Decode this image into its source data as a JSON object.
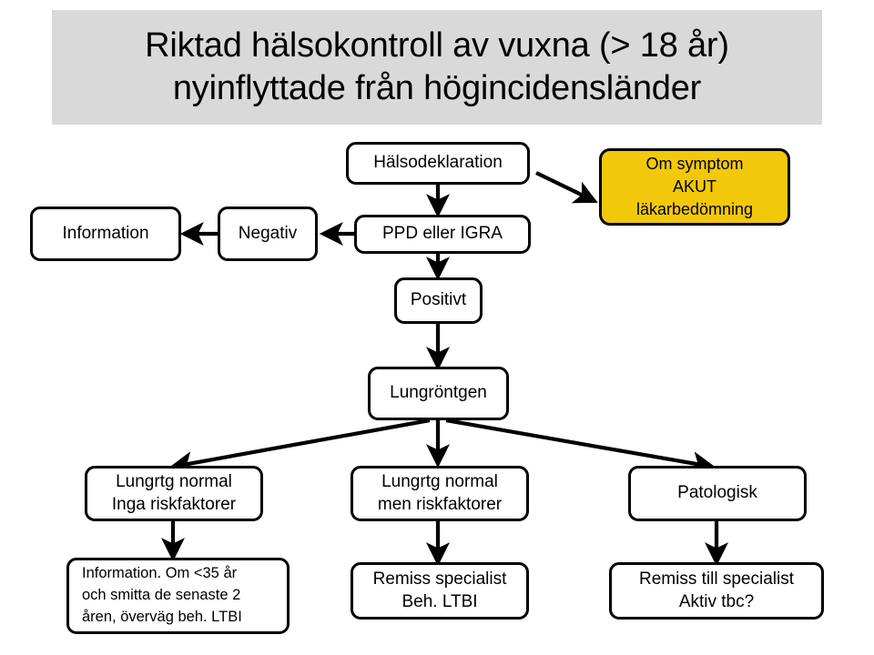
{
  "title": {
    "line1": "Riktad hälsokontroll av vuxna (> 18 år)",
    "line2": "nyinflyttade från högincidensländer",
    "background_color": "#D9D9D9"
  },
  "colors": {
    "page_background": "#FFFFFF",
    "node_fill": "#FFFFFF",
    "node_border": "#000000",
    "alert_fill": "#F2C80A",
    "text": "#000000"
  },
  "nodes": {
    "halsodeklaration": {
      "line1": "Hälsodeklaration"
    },
    "akut": {
      "line1": "Om symptom",
      "line2": "AKUT",
      "line3": "läkarbedömning"
    },
    "information_top": {
      "line1": "Information"
    },
    "negativ": {
      "line1": "Negativ"
    },
    "ppd_igra": {
      "line1": "PPD eller IGRA"
    },
    "positivt": {
      "line1": "Positivt"
    },
    "lungrontgen": {
      "line1": "Lungröntgen"
    },
    "normal_inga": {
      "line1": "Lungrtg normal",
      "line2": "Inga riskfaktorer"
    },
    "normal_men": {
      "line1": "Lungrtg normal",
      "line2": "men riskfaktorer"
    },
    "patologisk": {
      "line1": "Patologisk"
    },
    "info_ltbi": {
      "line1": "Information. Om <35 år",
      "line2": "och smitta de senaste 2",
      "line3": "åren, överväg beh. LTBI"
    },
    "remiss_specialist": {
      "line1": "Remiss specialist",
      "line2": "Beh. LTBI"
    },
    "remiss_till_specialist": {
      "line1": "Remiss till specialist",
      "line2": "Aktiv tbc?"
    }
  },
  "edges": [
    {
      "name": "halsodeklaration-to-akut",
      "from": "halsodeklaration",
      "to": "akut",
      "kind": "diagonal-arrow"
    },
    {
      "name": "halsodeklaration-to-ppd",
      "from": "halsodeklaration",
      "to": "ppd_igra",
      "kind": "down-arrow"
    },
    {
      "name": "ppd-to-negativ",
      "from": "ppd_igra",
      "to": "negativ",
      "kind": "left-arrow"
    },
    {
      "name": "negativ-to-information",
      "from": "negativ",
      "to": "information_top",
      "kind": "left-arrow"
    },
    {
      "name": "ppd-to-positivt",
      "from": "ppd_igra",
      "to": "positivt",
      "kind": "down-arrow"
    },
    {
      "name": "positivt-to-lungrontgen",
      "from": "positivt",
      "to": "lungrontgen",
      "kind": "down-arrow"
    },
    {
      "name": "lungrontgen-to-normal-inga",
      "from": "lungrontgen",
      "to": "normal_inga",
      "kind": "diagonal-arrow"
    },
    {
      "name": "lungrontgen-to-normal-men",
      "from": "lungrontgen",
      "to": "normal_men",
      "kind": "down-arrow"
    },
    {
      "name": "lungrontgen-to-patologisk",
      "from": "lungrontgen",
      "to": "patologisk",
      "kind": "diagonal-arrow"
    },
    {
      "name": "normal-inga-to-info-ltbi",
      "from": "normal_inga",
      "to": "info_ltbi",
      "kind": "down-arrow"
    },
    {
      "name": "normal-men-to-remiss",
      "from": "normal_men",
      "to": "remiss_specialist",
      "kind": "down-arrow"
    },
    {
      "name": "patologisk-to-remiss-till",
      "from": "patologisk",
      "to": "remiss_till_specialist",
      "kind": "down-arrow"
    }
  ]
}
